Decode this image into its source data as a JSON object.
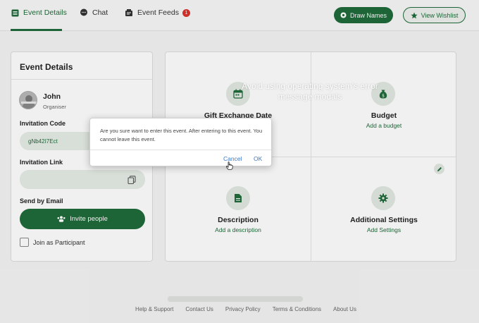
{
  "nav": {
    "tabs": [
      {
        "label": "Event Details",
        "icon": "list-icon",
        "active": true
      },
      {
        "label": "Chat",
        "icon": "chat-icon"
      },
      {
        "label": "Event Feeds",
        "icon": "feed-icon",
        "badge": "1"
      }
    ],
    "draw_names": "Draw Names",
    "view_wishlist": "View Wishlist"
  },
  "event_card": {
    "title": "Event Details",
    "user": {
      "name": "John",
      "role": "Organiser"
    },
    "invitation_code_label": "Invitation Code",
    "invitation_code": "gNb42I7Ect",
    "invitation_link_label": "Invitation Link",
    "send_by_email_label": "Send by Email",
    "invite_button": "Invite people",
    "join_label": "Join as Participant"
  },
  "grid": {
    "gift_exchange": {
      "title": "Gift Exchange Date"
    },
    "budget": {
      "title": "Budget",
      "link": "Add a budget"
    },
    "description": {
      "title": "Description",
      "link": "Add a description"
    },
    "settings": {
      "title": "Additional Settings",
      "link": "Add Settings"
    }
  },
  "footer": [
    "Help & Support",
    "Contact Us",
    "Privacy Policy",
    "Terms & Conditions",
    "About Us"
  ],
  "caption": "Avoid using operating system's error message modals",
  "dialog": {
    "message": "Are you sure want to enter this event. After entering to this event. You cannot leave this event.",
    "cancel": "Cancel",
    "ok": "OK"
  },
  "colors": {
    "accent": "#1f6b3a",
    "badge": "#d9342b",
    "link": "#3a78c9"
  }
}
